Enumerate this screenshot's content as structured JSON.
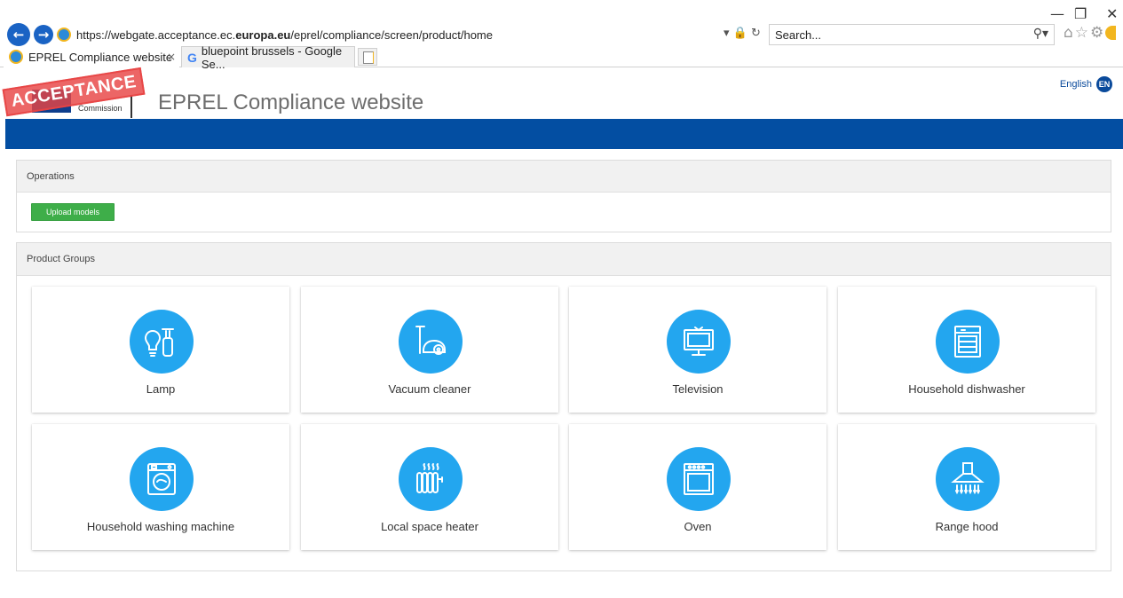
{
  "browser": {
    "url_prefix": "https://webgate.acceptance.ec.",
    "url_domain": "europa.eu",
    "url_path": "/eprel/compliance/screen/product/home",
    "search_placeholder": "Search...",
    "tabs": [
      {
        "label": "EPREL Compliance website"
      },
      {
        "label": "bluepoint brussels - Google Se..."
      }
    ],
    "window_controls": {
      "minimize": "—",
      "restore": "❐",
      "close": "✕"
    }
  },
  "header": {
    "stamp": "ACCEPTANCE",
    "logo_text": "Commission",
    "title": "EPREL Compliance website",
    "language_label": "English",
    "language_code": "EN"
  },
  "operations": {
    "heading": "Operations",
    "upload_label": "Upload models"
  },
  "product_groups": {
    "heading": "Product Groups",
    "items": [
      {
        "label": "Lamp",
        "icon": "lamp-icon"
      },
      {
        "label": "Vacuum cleaner",
        "icon": "vacuum-cleaner-icon"
      },
      {
        "label": "Television",
        "icon": "television-icon"
      },
      {
        "label": "Household dishwasher",
        "icon": "dishwasher-icon"
      },
      {
        "label": "Household washing machine",
        "icon": "washing-machine-icon"
      },
      {
        "label": "Local space heater",
        "icon": "space-heater-icon"
      },
      {
        "label": "Oven",
        "icon": "oven-icon"
      },
      {
        "label": "Range hood",
        "icon": "range-hood-icon"
      }
    ]
  },
  "colors": {
    "brand_blue": "#034ea2",
    "icon_circle": "#23a6ef",
    "upload_green": "#3eae49",
    "stamp_red": "#e84444"
  }
}
